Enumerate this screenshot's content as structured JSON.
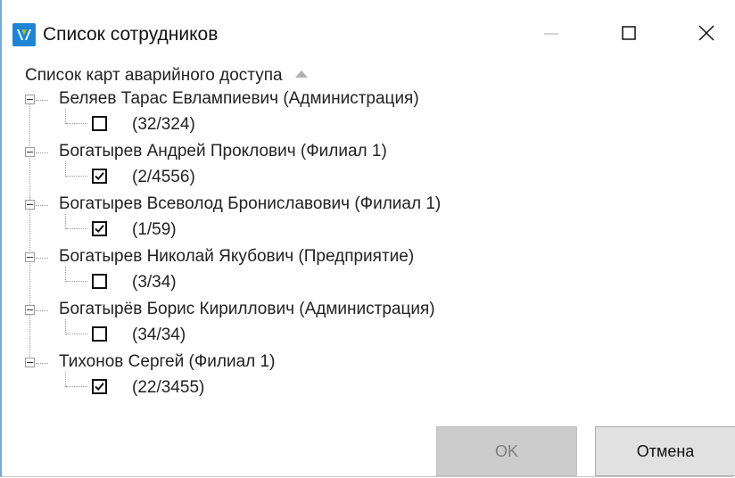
{
  "window": {
    "title": "Список сотрудников",
    "controls": {
      "minimize": "minimize-icon",
      "maximize": "maximize-icon",
      "close": "close-icon"
    }
  },
  "tree": {
    "column_header": "Список карт аварийного доступа",
    "sort_icon": "sort-ascending-icon",
    "items": [
      {
        "employee": "Беляев Тарас Евлампиевич (Администрация)",
        "card": "(32/324)",
        "checked": false
      },
      {
        "employee": "Богатырев Андрей Проклович (Филиал 1)",
        "card": "(2/4556)",
        "checked": true
      },
      {
        "employee": "Богатырев Всеволод Брониславович (Филиал 1)",
        "card": "(1/59)",
        "checked": true
      },
      {
        "employee": "Богатырев Николай Якубович (Предприятие)",
        "card": "(3/34)",
        "checked": false
      },
      {
        "employee": "Богатырёв Борис Кириллович (Администрация)",
        "card": "(34/34)",
        "checked": false
      },
      {
        "employee": "Тихонов Сергей (Филиал 1)",
        "card": "(22/3455)",
        "checked": true
      }
    ]
  },
  "footer": {
    "ok_label": "OK",
    "ok_enabled": false,
    "cancel_label": "Отмена"
  },
  "colors": {
    "accent": "#1c85d5",
    "border": "#7aa7d1"
  }
}
